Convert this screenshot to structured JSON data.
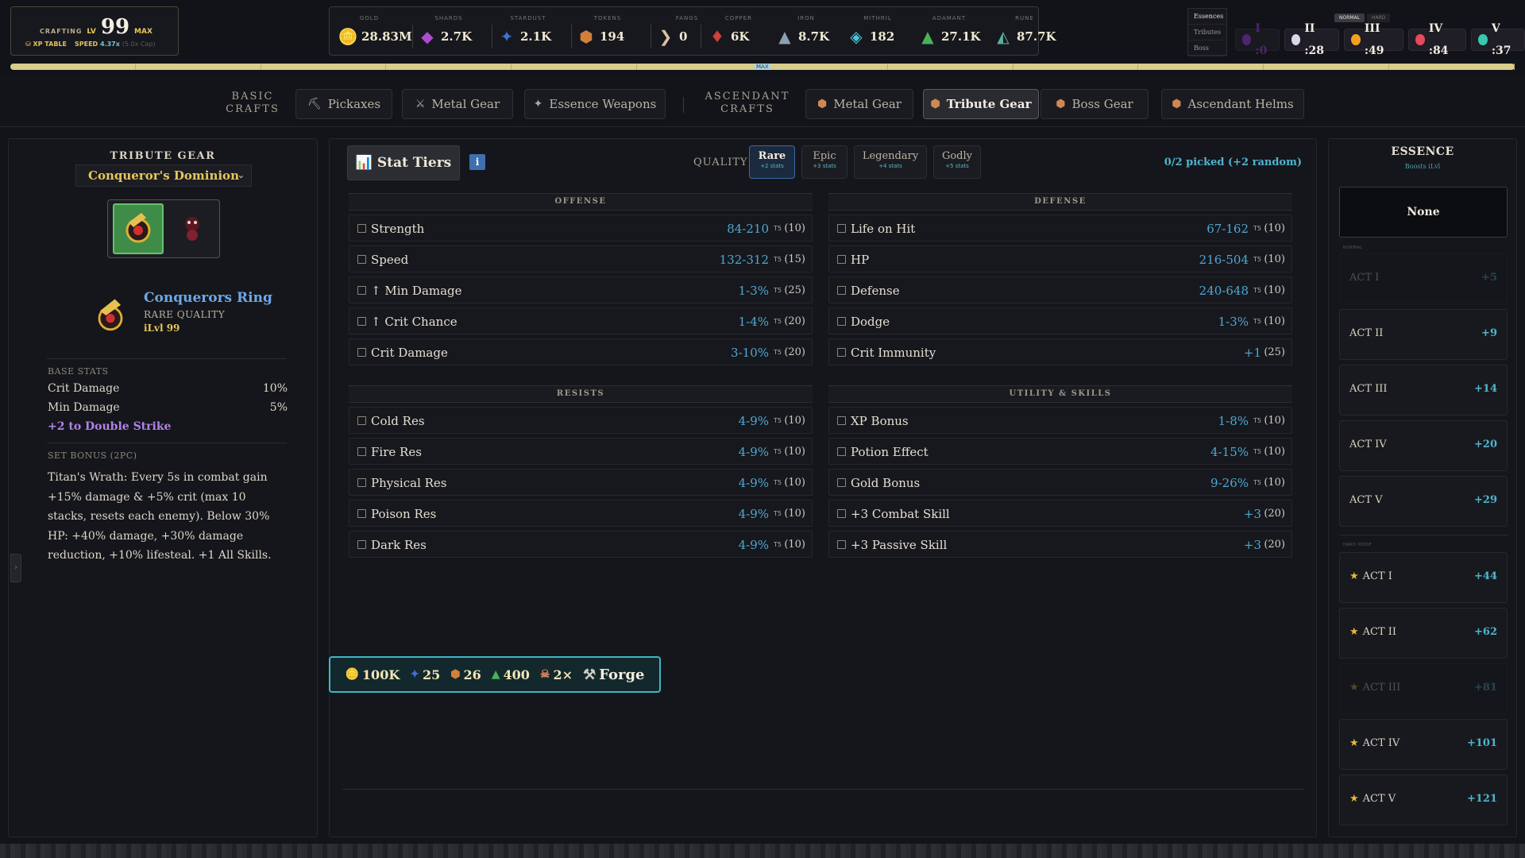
{
  "crafting": {
    "label": "CRAFTING",
    "lv_label": "LV",
    "level": "99",
    "max_label": "MAX",
    "xp_table": "⛁ XP TABLE",
    "speed_label": "SPEED",
    "speed_value": "4.37x",
    "speed_cap": "(5.0x Cap)"
  },
  "resources": [
    {
      "label": "GOLD",
      "value": "28.83M",
      "icon": "gold-coins-icon",
      "glyph": "🪙",
      "color": "#e0a030"
    },
    {
      "label": "SHARDS",
      "value": "2.7K",
      "icon": "shards-icon",
      "glyph": "◆",
      "color": "#b04ad0"
    },
    {
      "label": "STARDUST",
      "value": "2.1K",
      "icon": "stardust-icon",
      "glyph": "✦",
      "color": "#3f6fd8"
    },
    {
      "label": "TOKENS",
      "value": "194",
      "icon": "token-icon",
      "glyph": "⬢",
      "color": "#d0803a"
    },
    {
      "label": "FANGS",
      "value": "0",
      "icon": "fang-icon",
      "glyph": "❯",
      "color": "#d8c0a0"
    },
    {
      "label": "COPPER",
      "value": "6K",
      "icon": "copper-icon",
      "glyph": "♦",
      "color": "#d0403a"
    },
    {
      "label": "IRON",
      "value": "8.7K",
      "icon": "iron-icon",
      "glyph": "▲",
      "color": "#8ca0b0"
    },
    {
      "label": "MITHRIL",
      "value": "182",
      "icon": "mithril-icon",
      "glyph": "◈",
      "color": "#48c8d8"
    },
    {
      "label": "ADAMANT",
      "value": "27.1K",
      "icon": "adamant-icon",
      "glyph": "▲",
      "color": "#4ab05a"
    },
    {
      "label": "RUNE",
      "value": "87.7K",
      "icon": "rune-icon",
      "glyph": "◭",
      "color": "#5ab0a0"
    }
  ],
  "side_tabs": [
    "Essences",
    "Tributes",
    "Boss"
  ],
  "difficulty": {
    "normal": "NORMAL",
    "hard": "HARD"
  },
  "act_counts": [
    {
      "label": "I :0",
      "color": "#7a2fb0"
    },
    {
      "label": "II :28",
      "color": "#d8d8e8"
    },
    {
      "label": "III :49",
      "color": "#f0a020"
    },
    {
      "label": "IV :84",
      "color": "#e8485a"
    },
    {
      "label": "V :37",
      "color": "#38c8b0"
    }
  ],
  "xp_bar": {
    "max_label": "MAX",
    "progress": 1.0
  },
  "nav": {
    "basic_label": "BASIC\nCRAFTS",
    "ascendant_label": "ASCENDANT\nCRAFTS",
    "basic": [
      {
        "label": "Pickaxes",
        "icon": "pickaxe-icon",
        "glyph": "⛏"
      },
      {
        "label": "Metal Gear",
        "icon": "crossed-swords-icon",
        "glyph": "⚔"
      },
      {
        "label": "Essence Weapons",
        "icon": "sparkle-icon",
        "glyph": "✦"
      }
    ],
    "ascendant": [
      {
        "label": "Metal Gear",
        "icon": "shield-icon",
        "glyph": "⬢"
      },
      {
        "label": "Tribute Gear",
        "icon": "shield-icon",
        "glyph": "⬢",
        "active": true
      },
      {
        "label": "Boss Gear",
        "icon": "shield-icon",
        "glyph": "⬢"
      },
      {
        "label": "Ascendant Helms",
        "icon": "shield-icon",
        "glyph": "⬢"
      }
    ]
  },
  "left": {
    "title": "TRIBUTE GEAR",
    "set_select": "Conqueror's Dominion",
    "item": {
      "name": "Conquerors Ring",
      "quality": "RARE QUALITY",
      "ilvl": "iLvl 99"
    },
    "base_stats_label": "BASE STATS",
    "base_stats": [
      {
        "name": "Crit Damage",
        "value": "10%"
      },
      {
        "name": "Min Damage",
        "value": "5%"
      }
    ],
    "bonus_skill": "+2 to Double Strike",
    "set_bonus_label": "SET BONUS (2PC)",
    "set_bonus_text": "Titan's Wrath: Every 5s in combat gain +15% damage & +5% crit (max 10 stacks, resets each enemy). Below 30% HP: +40% damage, +30% damage reduction, +10% lifesteal. +1 All Skills."
  },
  "center": {
    "stat_tiers_label": "📊 Stat Tiers",
    "info_label": "i",
    "quality_label": "QUALITY",
    "qualities": [
      {
        "name": "Rare",
        "sub": "+2 stats",
        "active": true
      },
      {
        "name": "Epic",
        "sub": "+3 stats"
      },
      {
        "name": "Legendary",
        "sub": "+4 stats"
      },
      {
        "name": "Godly",
        "sub": "+5 stats"
      }
    ],
    "picked": "0/2 picked (+2 random)",
    "tier_mark": "T5",
    "offense": {
      "title": "OFFENSE",
      "rows": [
        {
          "name": "Strength",
          "range": "84-210",
          "weight": "(10)"
        },
        {
          "name": "Speed",
          "range": "132-312",
          "weight": "(15)"
        },
        {
          "name": "↑ Min Damage",
          "range": "1-3%",
          "weight": "(25)"
        },
        {
          "name": "↑ Crit Chance",
          "range": "1-4%",
          "weight": "(20)"
        },
        {
          "name": "Crit Damage",
          "range": "3-10%",
          "weight": "(20)"
        }
      ]
    },
    "defense": {
      "title": "DEFENSE",
      "rows": [
        {
          "name": "Life on Hit",
          "range": "67-162",
          "weight": "(10)"
        },
        {
          "name": "HP",
          "range": "216-504",
          "weight": "(10)"
        },
        {
          "name": "Defense",
          "range": "240-648",
          "weight": "(10)"
        },
        {
          "name": "Dodge",
          "range": "1-3%",
          "weight": "(10)"
        },
        {
          "name": "Crit Immunity",
          "range": "+1",
          "weight": "(25)",
          "no_tier": true
        }
      ]
    },
    "resists": {
      "title": "RESISTS",
      "rows": [
        {
          "name": "Cold Res",
          "range": "4-9%",
          "weight": "(10)"
        },
        {
          "name": "Fire Res",
          "range": "4-9%",
          "weight": "(10)"
        },
        {
          "name": "Physical Res",
          "range": "4-9%",
          "weight": "(10)"
        },
        {
          "name": "Poison Res",
          "range": "4-9%",
          "weight": "(10)"
        },
        {
          "name": "Dark Res",
          "range": "4-9%",
          "weight": "(10)"
        }
      ]
    },
    "utility": {
      "title": "UTILITY & SKILLS",
      "rows": [
        {
          "name": "XP Bonus",
          "range": "1-8%",
          "weight": "(10)"
        },
        {
          "name": "Potion Effect",
          "range": "4-15%",
          "weight": "(10)"
        },
        {
          "name": "Gold Bonus",
          "range": "9-26%",
          "weight": "(10)"
        },
        {
          "name": "+3 Combat Skill",
          "range": "+3",
          "weight": "(20)",
          "no_tier": true
        },
        {
          "name": "+3 Passive Skill",
          "range": "+3",
          "weight": "(20)",
          "no_tier": true
        }
      ]
    },
    "forge": {
      "costs": [
        {
          "value": "100K",
          "icon": "gold-coins-icon",
          "glyph": "🪙"
        },
        {
          "value": "25",
          "icon": "stardust-icon",
          "glyph": "✦"
        },
        {
          "value": "26",
          "icon": "token-icon",
          "glyph": "⬢"
        },
        {
          "value": "400",
          "icon": "adamant-icon",
          "glyph": "▲"
        },
        {
          "value": "2×",
          "icon": "skull-icon",
          "glyph": "☠"
        }
      ],
      "label": "Forge",
      "icon_glyph": "⚒"
    }
  },
  "right": {
    "title": "ESSENCE",
    "subtitle": "Boosts iLvl",
    "selected": "None",
    "normal_label": "NORMAL",
    "hard_label": "HARD MODE",
    "normal_acts": [
      {
        "name": "ACT I",
        "bonus": "+5",
        "dim": true
      },
      {
        "name": "ACT II",
        "bonus": "+9"
      },
      {
        "name": "ACT III",
        "bonus": "+14"
      },
      {
        "name": "ACT IV",
        "bonus": "+20"
      },
      {
        "name": "ACT V",
        "bonus": "+29"
      }
    ],
    "hard_acts": [
      {
        "name": "ACT I",
        "bonus": "+44"
      },
      {
        "name": "ACT II",
        "bonus": "+62"
      },
      {
        "name": "ACT III",
        "bonus": "+81",
        "dim": true
      },
      {
        "name": "ACT IV",
        "bonus": "+101"
      },
      {
        "name": "ACT V",
        "bonus": "+121"
      }
    ]
  }
}
